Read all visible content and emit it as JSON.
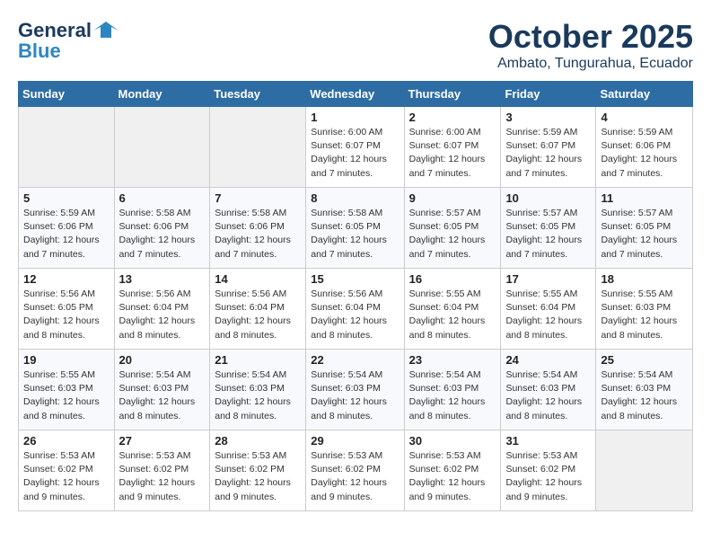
{
  "header": {
    "logo_line1": "General",
    "logo_line2": "Blue",
    "title": "October 2025",
    "subtitle": "Ambato, Tungurahua, Ecuador"
  },
  "weekdays": [
    "Sunday",
    "Monday",
    "Tuesday",
    "Wednesday",
    "Thursday",
    "Friday",
    "Saturday"
  ],
  "weeks": [
    [
      {
        "day": "",
        "info": ""
      },
      {
        "day": "",
        "info": ""
      },
      {
        "day": "",
        "info": ""
      },
      {
        "day": "1",
        "info": "Sunrise: 6:00 AM\nSunset: 6:07 PM\nDaylight: 12 hours\nand 7 minutes."
      },
      {
        "day": "2",
        "info": "Sunrise: 6:00 AM\nSunset: 6:07 PM\nDaylight: 12 hours\nand 7 minutes."
      },
      {
        "day": "3",
        "info": "Sunrise: 5:59 AM\nSunset: 6:07 PM\nDaylight: 12 hours\nand 7 minutes."
      },
      {
        "day": "4",
        "info": "Sunrise: 5:59 AM\nSunset: 6:06 PM\nDaylight: 12 hours\nand 7 minutes."
      }
    ],
    [
      {
        "day": "5",
        "info": "Sunrise: 5:59 AM\nSunset: 6:06 PM\nDaylight: 12 hours\nand 7 minutes."
      },
      {
        "day": "6",
        "info": "Sunrise: 5:58 AM\nSunset: 6:06 PM\nDaylight: 12 hours\nand 7 minutes."
      },
      {
        "day": "7",
        "info": "Sunrise: 5:58 AM\nSunset: 6:06 PM\nDaylight: 12 hours\nand 7 minutes."
      },
      {
        "day": "8",
        "info": "Sunrise: 5:58 AM\nSunset: 6:05 PM\nDaylight: 12 hours\nand 7 minutes."
      },
      {
        "day": "9",
        "info": "Sunrise: 5:57 AM\nSunset: 6:05 PM\nDaylight: 12 hours\nand 7 minutes."
      },
      {
        "day": "10",
        "info": "Sunrise: 5:57 AM\nSunset: 6:05 PM\nDaylight: 12 hours\nand 7 minutes."
      },
      {
        "day": "11",
        "info": "Sunrise: 5:57 AM\nSunset: 6:05 PM\nDaylight: 12 hours\nand 7 minutes."
      }
    ],
    [
      {
        "day": "12",
        "info": "Sunrise: 5:56 AM\nSunset: 6:05 PM\nDaylight: 12 hours\nand 8 minutes."
      },
      {
        "day": "13",
        "info": "Sunrise: 5:56 AM\nSunset: 6:04 PM\nDaylight: 12 hours\nand 8 minutes."
      },
      {
        "day": "14",
        "info": "Sunrise: 5:56 AM\nSunset: 6:04 PM\nDaylight: 12 hours\nand 8 minutes."
      },
      {
        "day": "15",
        "info": "Sunrise: 5:56 AM\nSunset: 6:04 PM\nDaylight: 12 hours\nand 8 minutes."
      },
      {
        "day": "16",
        "info": "Sunrise: 5:55 AM\nSunset: 6:04 PM\nDaylight: 12 hours\nand 8 minutes."
      },
      {
        "day": "17",
        "info": "Sunrise: 5:55 AM\nSunset: 6:04 PM\nDaylight: 12 hours\nand 8 minutes."
      },
      {
        "day": "18",
        "info": "Sunrise: 5:55 AM\nSunset: 6:03 PM\nDaylight: 12 hours\nand 8 minutes."
      }
    ],
    [
      {
        "day": "19",
        "info": "Sunrise: 5:55 AM\nSunset: 6:03 PM\nDaylight: 12 hours\nand 8 minutes."
      },
      {
        "day": "20",
        "info": "Sunrise: 5:54 AM\nSunset: 6:03 PM\nDaylight: 12 hours\nand 8 minutes."
      },
      {
        "day": "21",
        "info": "Sunrise: 5:54 AM\nSunset: 6:03 PM\nDaylight: 12 hours\nand 8 minutes."
      },
      {
        "day": "22",
        "info": "Sunrise: 5:54 AM\nSunset: 6:03 PM\nDaylight: 12 hours\nand 8 minutes."
      },
      {
        "day": "23",
        "info": "Sunrise: 5:54 AM\nSunset: 6:03 PM\nDaylight: 12 hours\nand 8 minutes."
      },
      {
        "day": "24",
        "info": "Sunrise: 5:54 AM\nSunset: 6:03 PM\nDaylight: 12 hours\nand 8 minutes."
      },
      {
        "day": "25",
        "info": "Sunrise: 5:54 AM\nSunset: 6:03 PM\nDaylight: 12 hours\nand 8 minutes."
      }
    ],
    [
      {
        "day": "26",
        "info": "Sunrise: 5:53 AM\nSunset: 6:02 PM\nDaylight: 12 hours\nand 9 minutes."
      },
      {
        "day": "27",
        "info": "Sunrise: 5:53 AM\nSunset: 6:02 PM\nDaylight: 12 hours\nand 9 minutes."
      },
      {
        "day": "28",
        "info": "Sunrise: 5:53 AM\nSunset: 6:02 PM\nDaylight: 12 hours\nand 9 minutes."
      },
      {
        "day": "29",
        "info": "Sunrise: 5:53 AM\nSunset: 6:02 PM\nDaylight: 12 hours\nand 9 minutes."
      },
      {
        "day": "30",
        "info": "Sunrise: 5:53 AM\nSunset: 6:02 PM\nDaylight: 12 hours\nand 9 minutes."
      },
      {
        "day": "31",
        "info": "Sunrise: 5:53 AM\nSunset: 6:02 PM\nDaylight: 12 hours\nand 9 minutes."
      },
      {
        "day": "",
        "info": ""
      }
    ]
  ]
}
